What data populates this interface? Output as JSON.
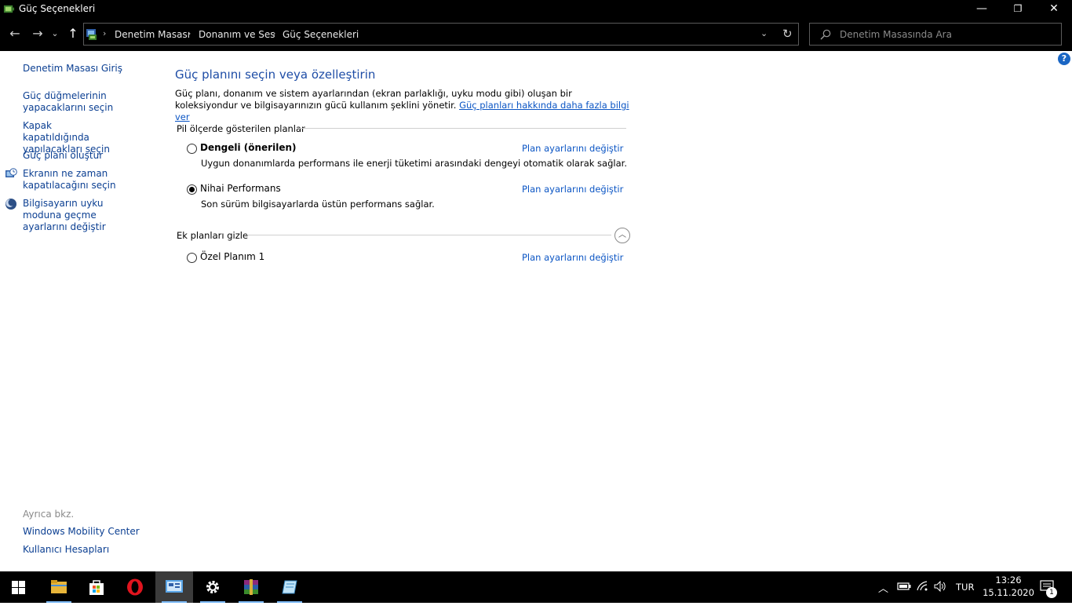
{
  "window": {
    "title": "Güç Seçenekleri",
    "minimize": "—",
    "maximize": "❐",
    "close": "✕"
  },
  "nav": {
    "back": "←",
    "forward": "→",
    "recent": "⌄",
    "up": "↑",
    "breadcrumb": [
      "Denetim Masası",
      "Donanım ve Ses",
      "Güç Seçenekleri"
    ],
    "dropdown": "⌄",
    "refresh": "↻"
  },
  "search": {
    "placeholder": "Denetim Masasında Ara"
  },
  "help": "?",
  "left_pane": {
    "home": "Denetim Masası Giriş",
    "items": [
      "Güç düğmelerinin yapacaklarını seçin",
      "Kapak kapatıldığında yapılacakları seçin",
      "Güç planı oluştur",
      "Ekranın ne zaman kapatılacağını seçin",
      "Bilgisayarın uyku moduna geçme ayarlarını değiştir"
    ],
    "see_also_label": "Ayrıca bkz.",
    "see_also": [
      "Windows Mobility Center",
      "Kullanıcı Hesapları"
    ]
  },
  "main": {
    "title": "Güç planını seçin veya özelleştirin",
    "description": "Güç planı, donanım ve sistem ayarlarından (ekran parlaklığı, uyku modu gibi) oluşan bir koleksiyondur ve bilgisayarınızın gücü kullanım şeklini yönetir.",
    "learn_more": "Güç planları hakkında daha fazla bilgi ver",
    "group1_label": "Pil ölçerde gösterilen planlar",
    "plans": [
      {
        "name": "Dengeli (önerilen)",
        "description": "Uygun donanımlarda performans ile enerji tüketimi arasındaki dengeyi otomatik olarak sağlar.",
        "link": "Plan ayarlarını değiştir",
        "selected": false
      },
      {
        "name": "Nihai Performans",
        "description": "Son sürüm bilgisayarlarda üstün performans sağlar.",
        "link": "Plan ayarlarını değiştir",
        "selected": true
      }
    ],
    "group2_label": "Ek planları gizle",
    "collapse": "︿",
    "extra_plans": [
      {
        "name": "Özel Planım 1",
        "link": "Plan ayarlarını değiştir",
        "selected": false
      }
    ]
  },
  "taskbar": {
    "language": "TUR",
    "time": "13:26",
    "date": "15.11.2020",
    "notification_count": "1"
  }
}
